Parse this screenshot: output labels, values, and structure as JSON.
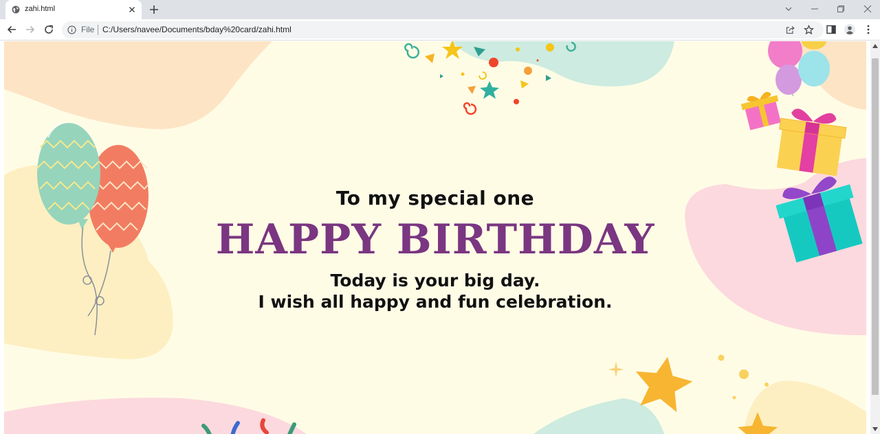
{
  "browser": {
    "tab": {
      "title": "zahi.html",
      "icon": "globe-icon"
    },
    "address": {
      "scheme_label": "File",
      "url": "C:/Users/navee/Documents/bday%20card/zahi.html"
    }
  },
  "card": {
    "line1": "To my special one",
    "title": "HAPPY BIRTHDAY",
    "message_line1": "Today is your big day.",
    "message_line2": "I wish all happy and fun celebration.",
    "title_color": "#7a3681",
    "background_color": "#fffce6"
  }
}
